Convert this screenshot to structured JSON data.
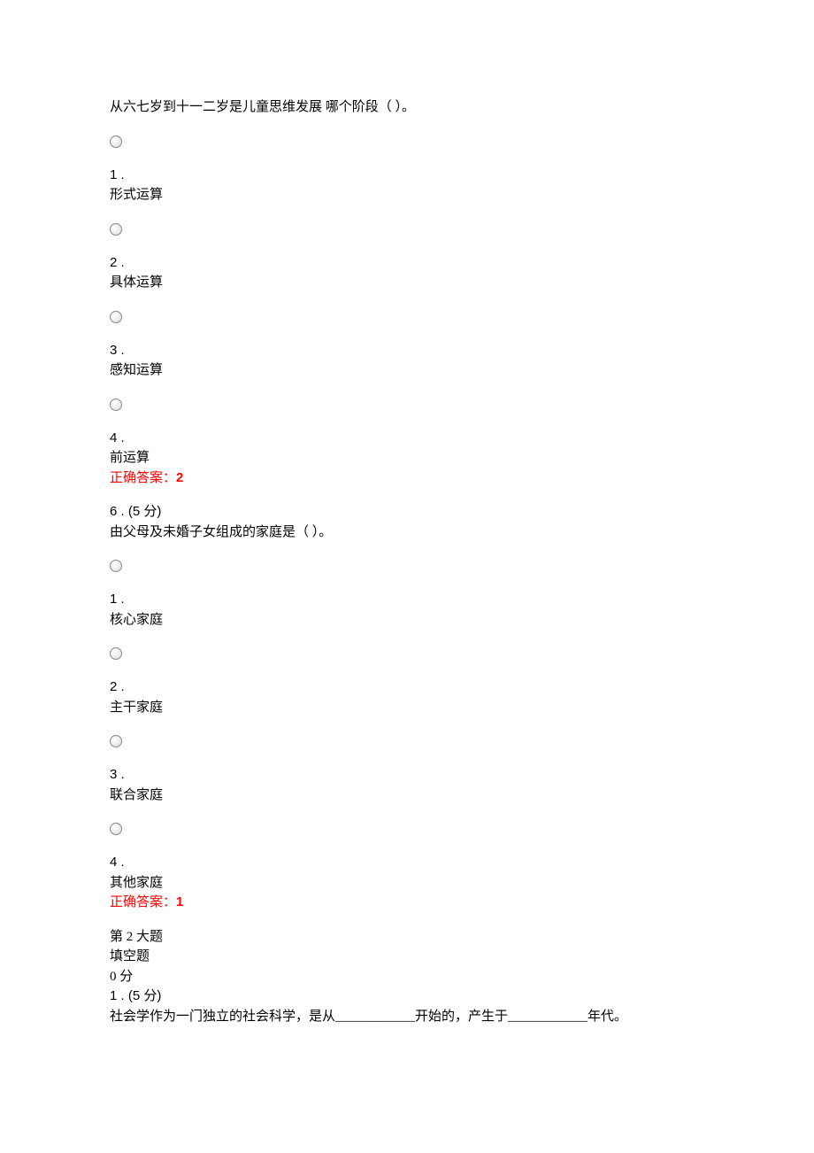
{
  "q5": {
    "stem": "从六七岁到十一二岁是儿童思维发展 哪个阶段（ ）。",
    "opts": {
      "n1": "1 .",
      "t1": "形式运算",
      "n2": "2 .",
      "t2": "具体运算",
      "n3": "3 .",
      "t3": "感知运算",
      "n4": "4 .",
      "t4": "前运算"
    },
    "answer_label": "正确答案：",
    "answer_value": "2"
  },
  "q6": {
    "header": "6 . (5 分)",
    "stem": "由父母及未婚子女组成的家庭是（ ）。",
    "opts": {
      "n1": "1 .",
      "t1": "核心家庭",
      "n2": "2 .",
      "t2": "主干家庭",
      "n3": "3 .",
      "t3": "联合家庭",
      "n4": "4 .",
      "t4": "其他家庭"
    },
    "answer_label": "正确答案：",
    "answer_value": "1"
  },
  "section2": {
    "title": "第 2 大题",
    "type": "填空题",
    "score": "0 分",
    "q1_header": "1 . (5 分)",
    "q1_stem": "社会学作为一门独立的社会科学，是从____________开始的，产生于____________年代。"
  }
}
